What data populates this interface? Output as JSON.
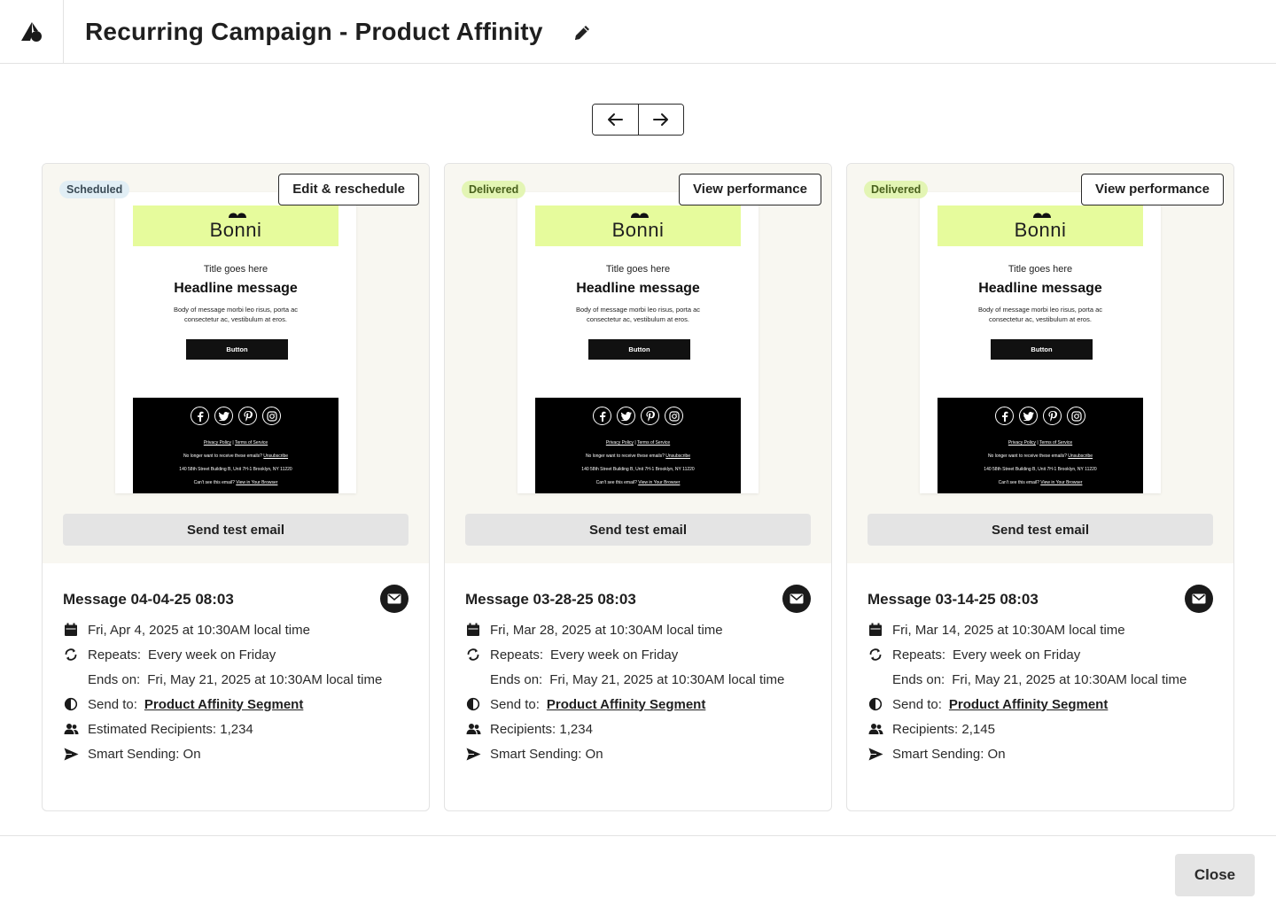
{
  "header": {
    "title": "Recurring Campaign - Product Affinity"
  },
  "colors": {
    "accent_green": "#e6fb9c",
    "badge_delivered": "#e3f5b4",
    "badge_scheduled": "#e1eef5",
    "card_top_bg": "#f8f7f1"
  },
  "pager": {
    "prev_icon": "arrow-left-icon",
    "next_icon": "arrow-right-icon"
  },
  "email_preview": {
    "brand": "Bonni",
    "title": "Title goes here",
    "headline": "Headline message",
    "body": "Body of message morbi leo risus, porta ac consectetur ac, vestibulum at eros.",
    "button": "Button",
    "privacy": "Privacy Policy",
    "separator": "|",
    "terms": "Terms of Service",
    "unsubscribe_text": "No longer want to receive these emails?",
    "unsubscribe_link": "Unsubscribe",
    "address": "140 58th Street Building B, Unit 7H-1 Brooklyn, NY 11220",
    "browser_text": "Can't see this email?",
    "browser_link": "View in Your Browser"
  },
  "cards": [
    {
      "status": "Scheduled",
      "action": "Edit & reschedule",
      "send_test": "Send test email",
      "message": "Message 04-04-25 08:03",
      "date": "Fri, Apr 4, 2025 at 10:30AM local time",
      "repeats_label": "Repeats:",
      "repeats": "Every week on Friday",
      "ends_label": "Ends on:",
      "ends": "Fri, May 21, 2025 at 10:30AM local time",
      "send_to_label": "Send to:",
      "segment": "Product Affinity Segment",
      "recipients": "Estimated Recipients: 1,234",
      "smart_sending": "Smart Sending: On"
    },
    {
      "status": "Delivered",
      "action": "View performance",
      "send_test": "Send test email",
      "message": "Message 03-28-25 08:03",
      "date": "Fri, Mar 28, 2025 at 10:30AM local time",
      "repeats_label": "Repeats:",
      "repeats": "Every week on Friday",
      "ends_label": "Ends on:",
      "ends": "Fri, May 21, 2025 at 10:30AM local time",
      "send_to_label": "Send to:",
      "segment": "Product Affinity Segment",
      "recipients": "Recipients: 1,234",
      "smart_sending": "Smart Sending: On"
    },
    {
      "status": "Delivered",
      "action": "View performance",
      "send_test": "Send test email",
      "message": "Message 03-14-25 08:03",
      "date": "Fri, Mar 14, 2025 at 10:30AM local time",
      "repeats_label": "Repeats:",
      "repeats": "Every week on Friday",
      "ends_label": "Ends on:",
      "ends": "Fri, May 21, 2025 at 10:30AM local time",
      "send_to_label": "Send to:",
      "segment": "Product Affinity Segment",
      "recipients": "Recipients: 2,145",
      "smart_sending": "Smart Sending: On"
    }
  ],
  "footer": {
    "close": "Close"
  }
}
